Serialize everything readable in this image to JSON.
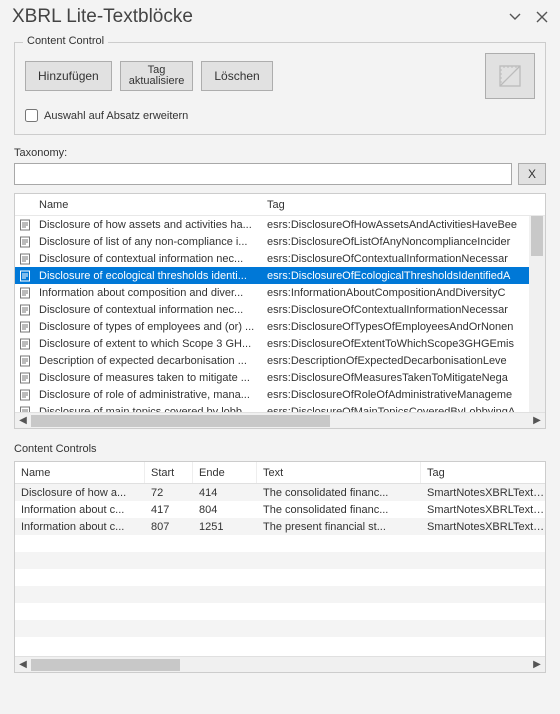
{
  "title": "XBRL Lite-Textblöcke",
  "contentControl": {
    "legend": "Content Control",
    "add": "Hinzufügen",
    "tag_line1": "Tag",
    "tag_line2": "aktualisiere",
    "delete": "Löschen",
    "expandCheckbox": "Auswahl auf Absatz erweitern"
  },
  "taxonomy": {
    "label": "Taxonomy:",
    "value": "",
    "clear": "X"
  },
  "grid1": {
    "headers": {
      "name": "Name",
      "tag": "Tag"
    },
    "selectedIndex": 3,
    "rows": [
      {
        "name": "Disclosure of how assets and activities ha...",
        "tag": "esrs:DisclosureOfHowAssetsAndActivitiesHaveBee"
      },
      {
        "name": "Disclosure of list of any non-compliance i...",
        "tag": "esrs:DisclosureOfListOfAnyNoncomplianceIncider"
      },
      {
        "name": "Disclosure of contextual information nec...",
        "tag": "esrs:DisclosureOfContextualInformationNecessar"
      },
      {
        "name": "Disclosure of ecological thresholds identi...",
        "tag": "esrs:DisclosureOfEcologicalThresholdsIdentifiedA"
      },
      {
        "name": "Information about composition and diver...",
        "tag": "esrs:InformationAboutCompositionAndDiversityC"
      },
      {
        "name": "Disclosure of contextual information nec...",
        "tag": "esrs:DisclosureOfContextualInformationNecessar"
      },
      {
        "name": "Disclosure of types of employees and (or) ...",
        "tag": "esrs:DisclosureOfTypesOfEmployeesAndOrNonen"
      },
      {
        "name": "Disclosure of extent to which Scope 3 GH...",
        "tag": "esrs:DisclosureOfExtentToWhichScope3GHGEmis"
      },
      {
        "name": "Description of expected decarbonisation ...",
        "tag": "esrs:DescriptionOfExpectedDecarbonisationLeve"
      },
      {
        "name": "Disclosure of measures taken to mitigate ...",
        "tag": "esrs:DisclosureOfMeasuresTakenToMitigateNega"
      },
      {
        "name": "Disclosure of role of administrative, mana...",
        "tag": "esrs:DisclosureOfRoleOfAdministrativeManageme"
      },
      {
        "name": "Disclosure of main topics covered by lobb...",
        "tag": "esrs:DisclosureOfMainTopicsCoveredByLobbyingA"
      }
    ]
  },
  "grid2": {
    "label": "Content Controls",
    "headers": {
      "name": "Name",
      "start": "Start",
      "ende": "Ende",
      "text": "Text",
      "tag": "Tag"
    },
    "rows": [
      {
        "name": "Disclosure of how a...",
        "start": "72",
        "ende": "414",
        "text": "The consolidated financ...",
        "tag": "SmartNotesXBRLTextblockT"
      },
      {
        "name": "Information about c...",
        "start": "417",
        "ende": "804",
        "text": "The consolidated financ...",
        "tag": "SmartNotesXBRLTextblockT"
      },
      {
        "name": "Information about c...",
        "start": "807",
        "ende": "1251",
        "text": "The present financial st...",
        "tag": "SmartNotesXBRLTextblockT"
      }
    ]
  }
}
